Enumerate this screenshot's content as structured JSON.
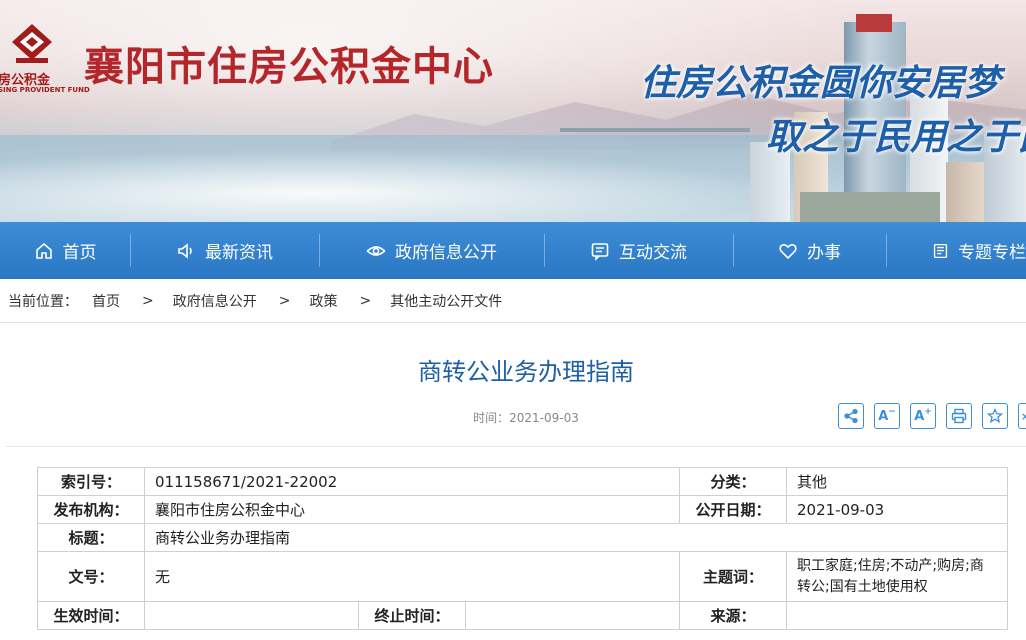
{
  "header": {
    "logo_text_cn": "房公积金",
    "logo_text_en": "SING PROVIDENT FUND",
    "site_title": "襄阳市住房公积金中心",
    "slogan_line1": "住房公积金圆你安居梦",
    "slogan_line2": "取之于民用之于民"
  },
  "nav": {
    "items": [
      {
        "label": "首页",
        "icon": "home-icon"
      },
      {
        "label": "最新资讯",
        "icon": "speaker-icon"
      },
      {
        "label": "政府信息公开",
        "icon": "eye-icon"
      },
      {
        "label": "互动交流",
        "icon": "message-icon"
      },
      {
        "label": "办事",
        "icon": "heart-icon"
      },
      {
        "label": "专题专栏",
        "icon": "topic-icon"
      }
    ]
  },
  "breadcrumb": {
    "prefix": "当前位置：",
    "items": [
      "首页",
      "政府信息公开",
      "政策",
      "其他主动公开文件"
    ],
    "separator": ">"
  },
  "article": {
    "title": "商转公业务办理指南",
    "time_label": "时间：",
    "time_value": "2021-09-03"
  },
  "tools": {
    "share_icon": "share-icon",
    "font_decrease": "A",
    "font_increase": "A",
    "print_icon": "print-icon",
    "favorite_icon": "star-icon"
  },
  "meta": {
    "index_label": "索引号：",
    "index_value": "011158671/2021-22002",
    "category_label": "分类：",
    "category_value": "其他",
    "publisher_label": "发布机构：",
    "publisher_value": "襄阳市住房公积金中心",
    "publish_date_label": "公开日期：",
    "publish_date_value": "2021-09-03",
    "title_label": "标题：",
    "title_value": "商转公业务办理指南",
    "doc_no_label": "文号：",
    "doc_no_value": "无",
    "keywords_label": "主题词：",
    "keywords_value": "职工家庭;住房;不动产;购房;商转公;国有土地使用权",
    "effective_label": "生效时间：",
    "effective_value": "",
    "expiry_label": "终止时间：",
    "expiry_value": "",
    "source_label": "来源：",
    "source_value": ""
  },
  "colors": {
    "brand_red": "#b3262a",
    "nav_blue": "#2f7fcc",
    "title_blue": "#1f5fa5",
    "slogan_blue": "#1d5fa8"
  }
}
